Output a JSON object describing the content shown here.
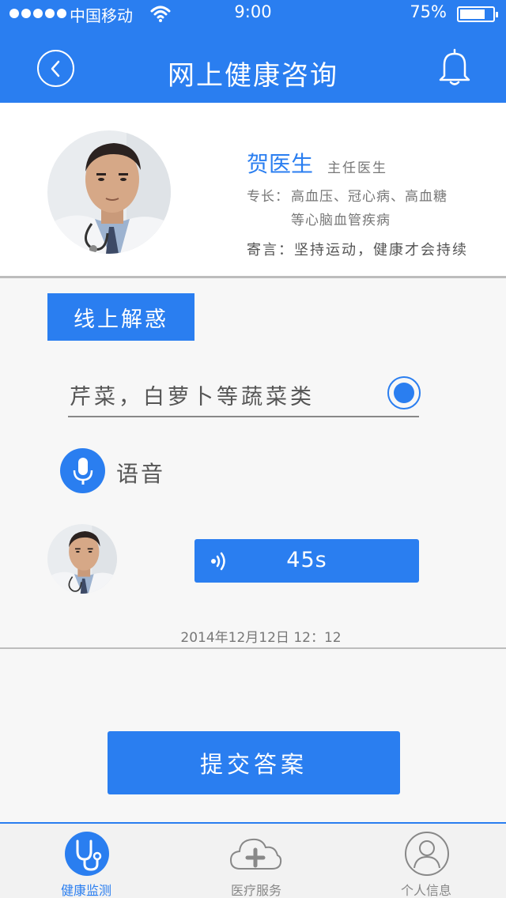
{
  "status_bar": {
    "carrier": "中国移动",
    "time": "9:00",
    "battery": "75%"
  },
  "header": {
    "title": "网上健康咨询",
    "back_icon": "chevron-left-icon",
    "bell_icon": "bell-icon"
  },
  "doctor": {
    "name": "贺医生",
    "title": "主任医生",
    "specialty_label": "专长：",
    "specialty_line1": "高血压、冠心病、高血糖",
    "specialty_line2": "等心脑血管疾病",
    "motto": "寄言：坚持运动，健康才会持续"
  },
  "consult": {
    "section_tag": "线上解惑",
    "answer_text": "芹菜，白萝卜等蔬菜类",
    "voice_label": "语音",
    "voice_duration": "45s",
    "timestamp": "2014年12月12日   12：12",
    "submit_label": "提交答案"
  },
  "tabs": [
    {
      "label": "健康监测",
      "icon": "stethoscope-icon",
      "active": true
    },
    {
      "label": "医疗服务",
      "icon": "cloud-medical-icon",
      "active": false
    },
    {
      "label": "个人信息",
      "icon": "person-icon",
      "active": false
    }
  ],
  "colors": {
    "accent": "#2a7ef0",
    "background": "#f7f7f7",
    "divider": "#bdbdbd"
  }
}
